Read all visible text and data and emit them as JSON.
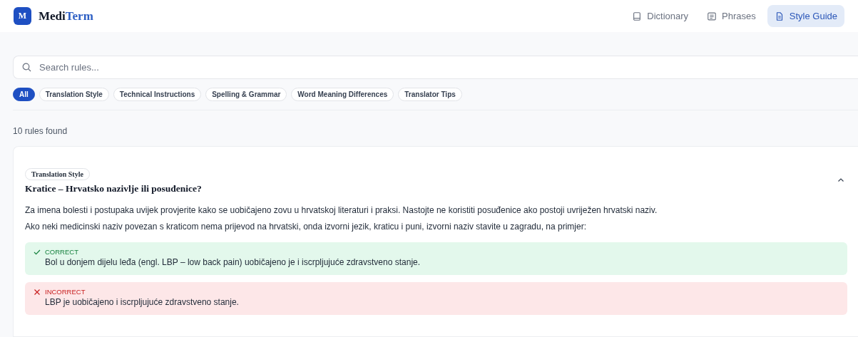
{
  "brand": {
    "logo_letter": "M",
    "name_start": "Medi",
    "name_end": "Term"
  },
  "nav": [
    {
      "label": "Dictionary",
      "kind": "book",
      "selected": false
    },
    {
      "label": "Phrases",
      "kind": "message",
      "selected": false
    },
    {
      "label": "Style Guide",
      "kind": "document",
      "selected": true
    }
  ],
  "search": {
    "placeholder": "Search rules..."
  },
  "filters": [
    {
      "label": "All",
      "selected": true
    },
    {
      "label": "Translation Style",
      "selected": false
    },
    {
      "label": "Technical Instructions",
      "selected": false
    },
    {
      "label": "Spelling & Grammar",
      "selected": false
    },
    {
      "label": "Word Meaning Differences",
      "selected": false
    },
    {
      "label": "Translator Tips",
      "selected": false
    }
  ],
  "result_count": "10 rules found",
  "rules": [
    {
      "category": "Translation Style",
      "title": "Kratice – Hrvatsko nazivlje ili posuđenice?",
      "expanded": true,
      "paragraphs": [
        "Za imena bolesti i postupaka uvijek provjerite kako se uobičajeno zovu u hrvatskoj literaturi i praksi. Nastojte ne koristiti posuđenice ako postoji uvriježen hrvatski naziv.",
        "Ako neki medicinski naziv povezan s kraticom nema prijevod na hrvatski, onda izvorni jezik, kraticu i puni, izvorni naziv stavite u zagradu, na primjer:"
      ],
      "examples": [
        {
          "kind": "correct",
          "label": "CORRECT",
          "text": "Bol u donjem dijelu leđa (engl. LBP – low back pain) uobičajeno je i iscrpljujuće zdravstveno stanje."
        },
        {
          "kind": "incorrect",
          "label": "INCORRECT",
          "text": "LBP je uobičajeno i iscrpljujuće zdravstveno stanje."
        }
      ]
    }
  ]
}
